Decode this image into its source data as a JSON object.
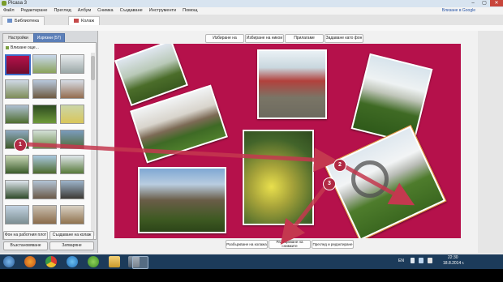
{
  "window": {
    "title": "Picasa 3",
    "min": "–",
    "max": "▢",
    "close": "✕"
  },
  "menu": {
    "items": [
      "Файл",
      "Редактиране",
      "Преглед",
      "Албум",
      "Снимка",
      "Създаване",
      "Инструменти",
      "Помощ"
    ],
    "signin": "Влизане в Google"
  },
  "tabs": [
    {
      "label": "Библиотека"
    },
    {
      "label": "Колаж"
    }
  ],
  "sidebar": {
    "tabs": [
      "Настройки",
      "Изрязни (57)"
    ],
    "search_label": "Влизане още...",
    "buttons": {
      "desktop_bg": "Фон на работния плот",
      "create_collage": "Създаване на колаж",
      "reset": "Възстановяване",
      "close": "Затваряне"
    }
  },
  "toolbar": [
    "Избиране на всички",
    "Избиране на никои",
    "Прилагаме",
    "Задаване като фон"
  ],
  "bottom": {
    "shuffle": "Разбъркване на колажа",
    "swap_a": "Разбъркване на",
    "swap_b": "снимките",
    "view_edit": "Преглед и редактиране"
  },
  "markers": [
    "1",
    "2",
    "3"
  ],
  "tray": {
    "lang": "EN",
    "time": "22:30",
    "date": "18.8.2014 г."
  },
  "colors": {
    "canvas": "#b5114b",
    "arrow": "#c4384f",
    "taskbar": "#1c3b5a",
    "accent": "#5c7fb8"
  },
  "icons": [
    "start-icon",
    "firefox-icon",
    "chrome-icon",
    "ie-icon",
    "utorrent-icon",
    "explorer-icon",
    "media-icon",
    "picasa-icon"
  ]
}
